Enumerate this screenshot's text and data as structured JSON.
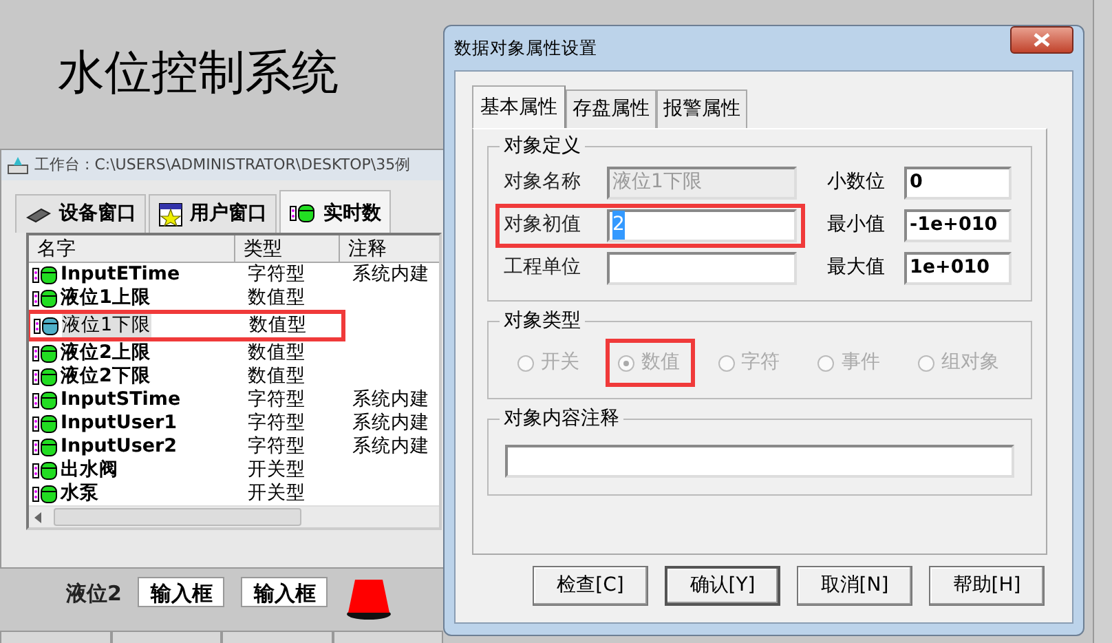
{
  "app_title": "水位控制系统",
  "workbench": {
    "title": "工作台 : C:\\USERS\\ADMINISTRATOR\\DESKTOP\\35例",
    "tabs": [
      {
        "label": "设备窗口",
        "kind": "chip",
        "selected": false
      },
      {
        "label": "用户窗口",
        "kind": "star",
        "selected": false
      },
      {
        "label": "实时数",
        "kind": "data",
        "selected": true
      }
    ],
    "columns": [
      "名字",
      "类型",
      "注释"
    ],
    "rows": [
      {
        "name": "InputETime",
        "type": "字符型",
        "note": "系统内建",
        "selected": false,
        "highlighted": false
      },
      {
        "name": "液位1上限",
        "type": "数值型",
        "note": "",
        "selected": false,
        "highlighted": false
      },
      {
        "name": "液位1下限",
        "type": "数值型",
        "note": "",
        "selected": true,
        "highlighted": true
      },
      {
        "name": "液位2上限",
        "type": "数值型",
        "note": "",
        "selected": false,
        "highlighted": false
      },
      {
        "name": "液位2下限",
        "type": "数值型",
        "note": "",
        "selected": false,
        "highlighted": false
      },
      {
        "name": "InputSTime",
        "type": "字符型",
        "note": "系统内建",
        "selected": false,
        "highlighted": false
      },
      {
        "name": "InputUser1",
        "type": "字符型",
        "note": "系统内建",
        "selected": false,
        "highlighted": false
      },
      {
        "name": "InputUser2",
        "type": "字符型",
        "note": "系统内建",
        "selected": false,
        "highlighted": false
      },
      {
        "name": "出水阀",
        "type": "开关型",
        "note": "",
        "selected": false,
        "highlighted": false
      },
      {
        "name": "水泵",
        "type": "开关型",
        "note": "",
        "selected": false,
        "highlighted": false
      }
    ]
  },
  "screen_bottom": {
    "label": "液位2",
    "inputs": [
      "输入框",
      "输入框"
    ]
  },
  "dialog": {
    "title": "数据对象属性设置",
    "tabs": [
      {
        "label": "基本属性",
        "selected": true
      },
      {
        "label": "存盘属性",
        "selected": false
      },
      {
        "label": "报警属性",
        "selected": false
      }
    ],
    "definition": {
      "legend": "对象定义",
      "fields": [
        {
          "label": "对象名称",
          "value": "液位1下限",
          "disabled": true,
          "highlighted": false,
          "text_selected": false
        },
        {
          "label": "对象初值",
          "value": "2",
          "disabled": false,
          "highlighted": true,
          "text_selected": true
        },
        {
          "label": "工程单位",
          "disabled": false,
          "highlighted": false
        }
      ],
      "right_fields": [
        {
          "label": "小数位",
          "value": "0"
        },
        {
          "label": "最小值",
          "value": "-1e+010"
        },
        {
          "label": "最大值",
          "value": "1e+010"
        }
      ]
    },
    "type_group": {
      "legend": "对象类型",
      "disabled": true,
      "options": [
        {
          "label": "开关",
          "selected": false,
          "highlighted": false
        },
        {
          "label": "数值",
          "selected": true,
          "highlighted": true
        },
        {
          "label": "字符",
          "selected": false,
          "highlighted": false
        },
        {
          "label": "事件",
          "selected": false,
          "highlighted": false
        },
        {
          "label": "组对象",
          "selected": false,
          "highlighted": false
        }
      ]
    },
    "comment_group": {
      "legend": "对象内容注释"
    },
    "buttons": [
      "检查[C]",
      "确认[Y]",
      "取消[N]",
      "帮助[H]"
    ]
  }
}
